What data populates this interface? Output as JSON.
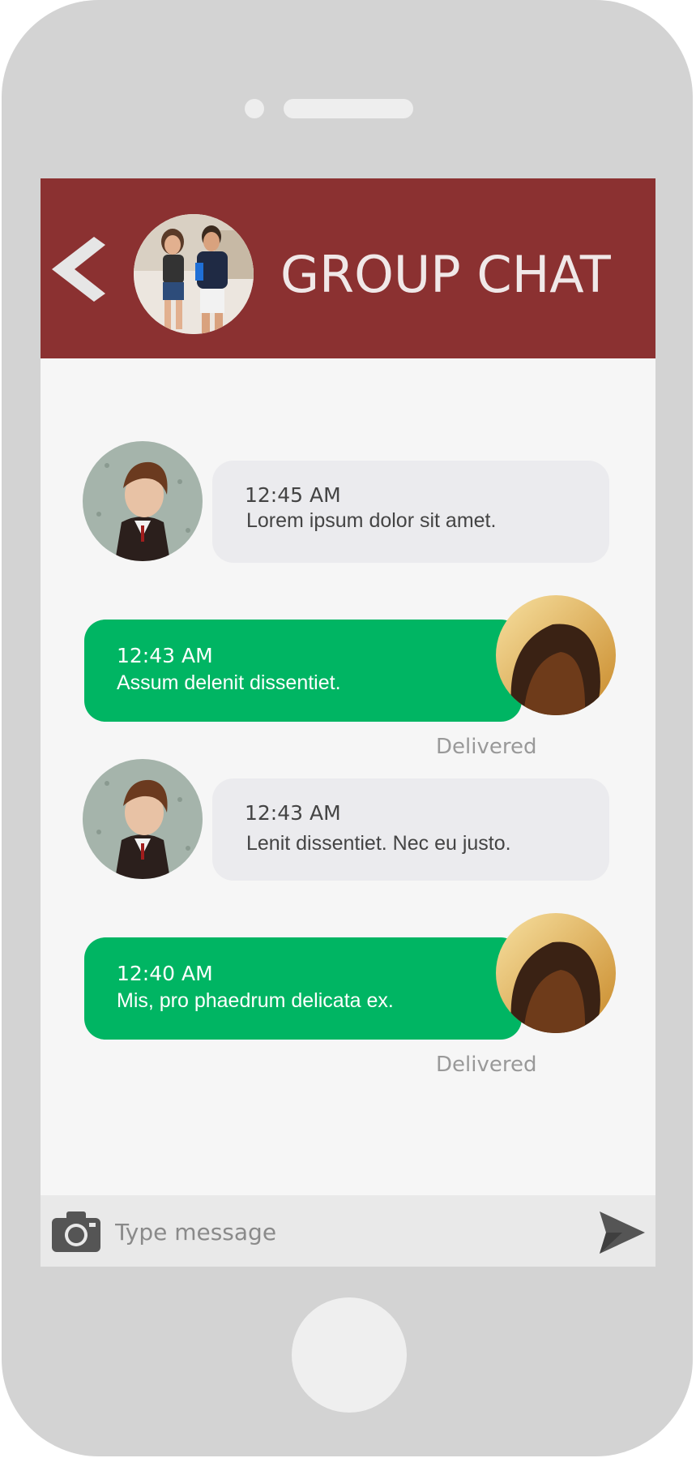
{
  "header": {
    "title": "GROUP CHAT",
    "color": "#8b3131"
  },
  "messages": [
    {
      "direction": "received",
      "time": "12:45 AM",
      "text": "Lorem ipsum dolor sit amet.",
      "avatar": "boy-avatar"
    },
    {
      "direction": "sent",
      "time": "12:43 AM",
      "text": "Assum delenit dissentiet.",
      "avatar": "girl-avatar",
      "status": "Delivered"
    },
    {
      "direction": "received",
      "time": "12:43 AM",
      "text": "Lenit dissentiet. Nec eu justo.",
      "avatar": "boy-avatar"
    },
    {
      "direction": "sent",
      "time": "12:40 AM",
      "text": "Mis, pro phaedrum delicata ex.",
      "avatar": "girl-avatar",
      "status": "Delivered"
    }
  ],
  "input": {
    "placeholder": "Type message"
  },
  "icons": {
    "back": "chevron-left-icon",
    "camera": "camera-icon",
    "send": "send-icon"
  },
  "colors": {
    "sent_bubble": "#00b563",
    "received_bubble": "#ebebee"
  }
}
